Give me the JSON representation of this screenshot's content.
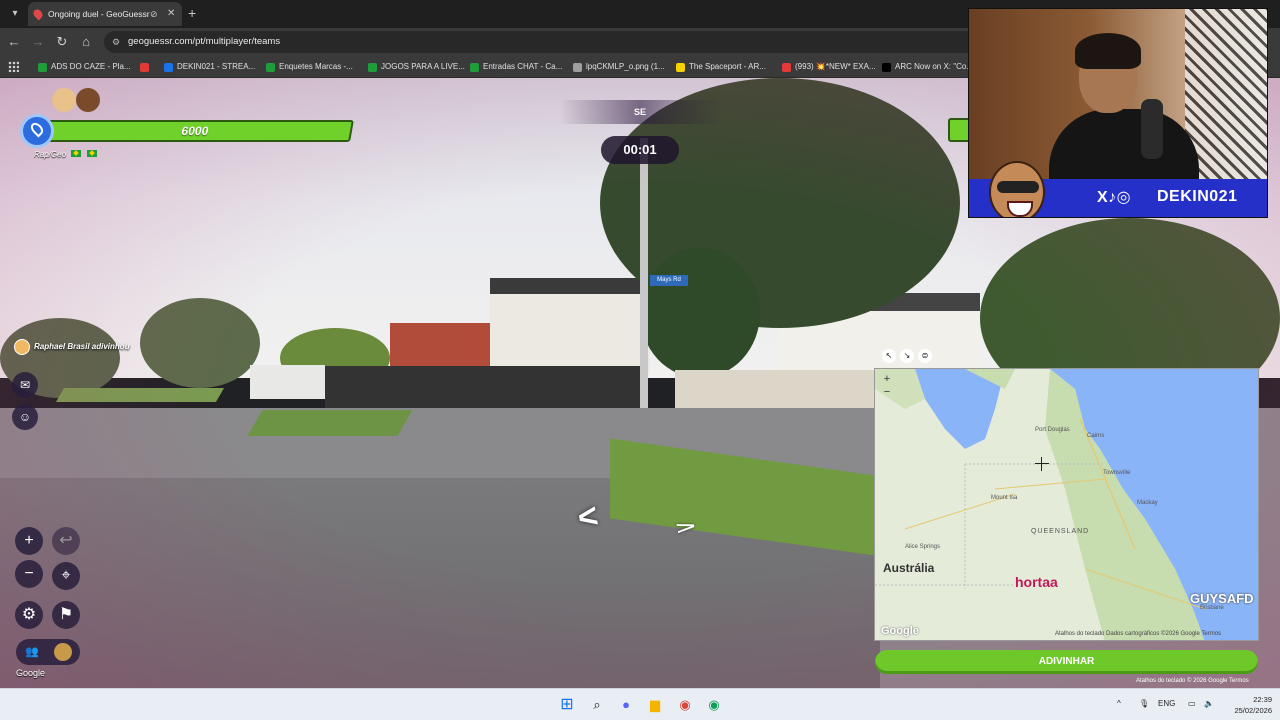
{
  "browser": {
    "tab_title": "Ongoing duel - GeoGuessr",
    "url": "geoguessr.com/pt/multiplayer/teams",
    "bookmarks": [
      {
        "label": "ADS DO CAZE - Pla...",
        "color": "#1e9d3b"
      },
      {
        "label": "",
        "color": "#e53935"
      },
      {
        "label": "DEKIN021 - STREA...",
        "color": "#1a73e8"
      },
      {
        "label": "Enquetes Marcas -...",
        "color": "#1e9d3b"
      },
      {
        "label": "JOGOS PARA A LIVE...",
        "color": "#1e9d3b"
      },
      {
        "label": "Entradas CHAT - Ca...",
        "color": "#1e9d3b"
      },
      {
        "label": "lpqCKMLP_o.png (1...",
        "color": "#9e9e9e"
      },
      {
        "label": "The Spaceport - AR...",
        "color": "#f4d200"
      },
      {
        "label": "(993) 💥*NEW* EXA...",
        "color": "#e53935"
      },
      {
        "label": "ARC Now on X: \"Co...",
        "color": "#000000"
      }
    ]
  },
  "game": {
    "team_health": "6000",
    "team_name": "Rap/Geo",
    "compass_label": "SE",
    "timer": "00:01",
    "guessed_notice": "Raphael Brasil adivinhou",
    "street_sign": "Mays Rd",
    "guess_button": "ADIVINHAR",
    "google_label": "Google",
    "bottom_attribution": "Atalhos do teclado   © 2026 Google   Termos"
  },
  "minimap": {
    "country_label": "Austrália",
    "region_label": "QUEENSLAND",
    "places": [
      "Port Douglas",
      "Cairns",
      "Townsville",
      "Mackay",
      "Mount Isa",
      "Alice Springs",
      "Brisbane"
    ],
    "marker_label": "hortaa",
    "overlay_label": "GUYSAFD",
    "footer": "Atalhos do teclado   Dados cartográficos ©2026 Google   Termos",
    "google_logo": "Google"
  },
  "webcam": {
    "handle": "DEKIN021",
    "socials": "X♪◎"
  },
  "taskbar": {
    "lang": "ENG",
    "time": "22:39",
    "date": "25/02/2026"
  },
  "colors": {
    "health_green": "#6fd12a",
    "guess_green": "#6fc82a",
    "banner_blue": "#2430c8"
  }
}
